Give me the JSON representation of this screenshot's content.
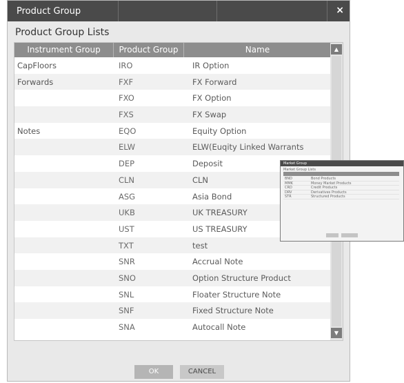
{
  "dialog": {
    "title": "Product Group",
    "close_label": "×",
    "subtitle": "Product Group Lists"
  },
  "grid": {
    "columns": [
      "Instrument Group",
      "Product Group",
      "Name"
    ],
    "rows": [
      {
        "instrument": "CapFloors",
        "code": "IRO",
        "name": "IR Option"
      },
      {
        "instrument": "Forwards",
        "code": "FXF",
        "name": "FX Forward"
      },
      {
        "instrument": "",
        "code": "FXO",
        "name": "FX Option"
      },
      {
        "instrument": "",
        "code": "FXS",
        "name": "FX Swap"
      },
      {
        "instrument": "Notes",
        "code": "EQO",
        "name": "Equity Option"
      },
      {
        "instrument": "",
        "code": "ELW",
        "name": "ELW(Euqity Linked Warrants"
      },
      {
        "instrument": "",
        "code": "DEP",
        "name": "Deposit"
      },
      {
        "instrument": "",
        "code": "CLN",
        "name": "CLN"
      },
      {
        "instrument": "",
        "code": "ASG",
        "name": "Asia Bond"
      },
      {
        "instrument": "",
        "code": "UKB",
        "name": "UK TREASURY"
      },
      {
        "instrument": "",
        "code": "UST",
        "name": "US TREASURY"
      },
      {
        "instrument": "",
        "code": "TXT",
        "name": "test"
      },
      {
        "instrument": "",
        "code": "SNR",
        "name": "Accrual Note"
      },
      {
        "instrument": "",
        "code": "SNO",
        "name": "Option Structure Product"
      },
      {
        "instrument": "",
        "code": "SNL",
        "name": "Floater Structure Note"
      },
      {
        "instrument": "",
        "code": "SNF",
        "name": "Fixed Structure Note"
      },
      {
        "instrument": "",
        "code": "SNA",
        "name": "Autocall Note"
      }
    ],
    "scroll_up_icon": "triangle-up-icon",
    "scroll_down_icon": "triangle-down-icon",
    "scroll_up_glyph": "▲",
    "scroll_down_glyph": "▼"
  },
  "buttons": {
    "ok": "OK",
    "cancel": "CANCEL"
  },
  "mini_window": {
    "title": "Market Group",
    "subtitle": "Market Group Lists",
    "rows": [
      {
        "code": "BND",
        "name": "Bond Products"
      },
      {
        "code": "MMK",
        "name": "Money Market Products"
      },
      {
        "code": "CRD",
        "name": "Credit Products"
      },
      {
        "code": "DRV",
        "name": "Derivatives Products"
      },
      {
        "code": "STR",
        "name": "Structured Products"
      }
    ]
  }
}
